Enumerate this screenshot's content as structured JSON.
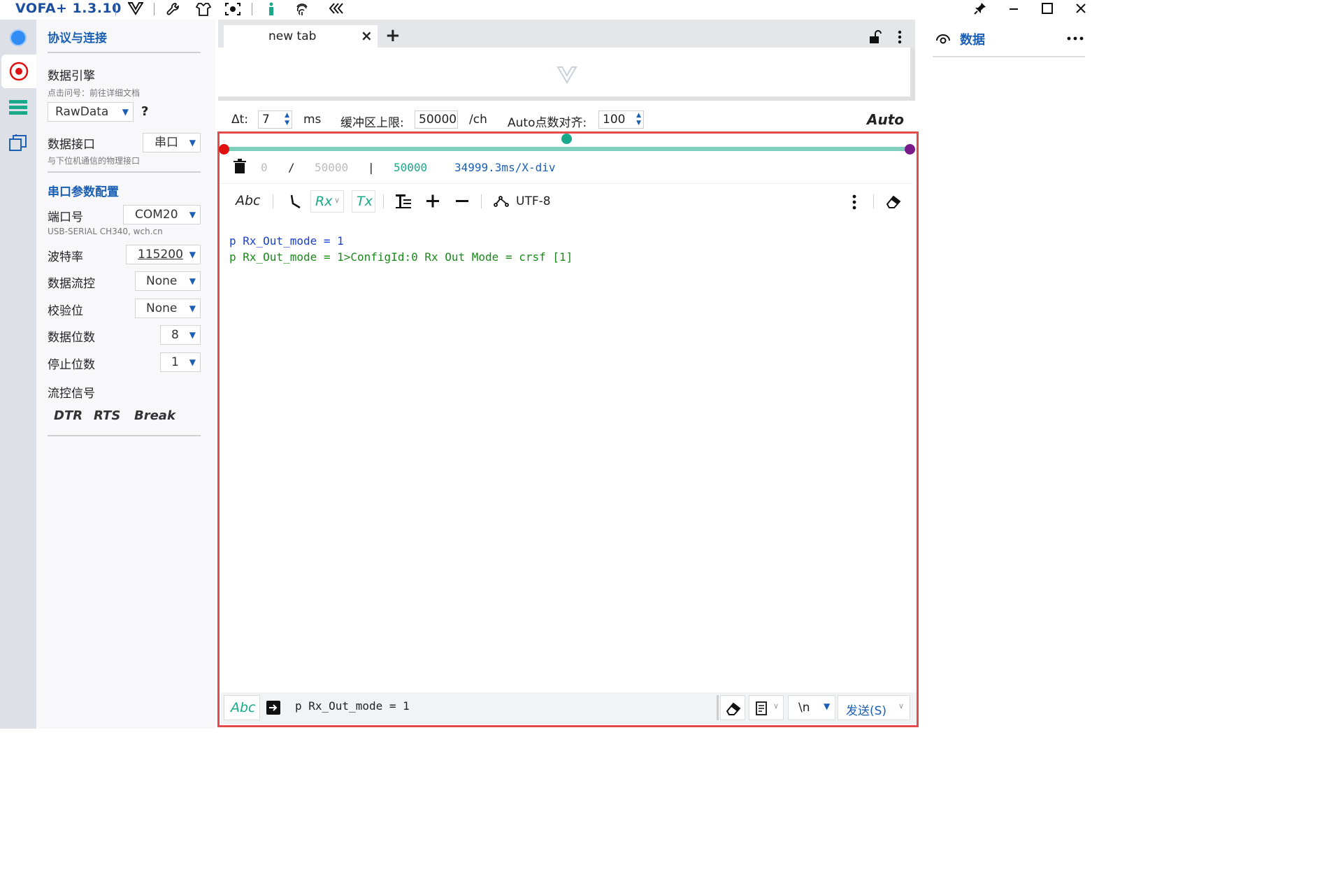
{
  "app": {
    "title": "VOFA+ 1.3.10"
  },
  "left_panel": {
    "section_title": "协议与连接",
    "engine_label": "数据引擎",
    "engine_hint": "点击问号：前往详细文档",
    "engine_value": "RawData",
    "help_label": "?",
    "interface_label": "数据接口",
    "interface_value": "串口",
    "interface_hint": "与下位机通信的物理接口",
    "serial_title": "串口参数配置",
    "port_label": "端口号",
    "port_value": "COM20",
    "port_hint": "USB-SERIAL CH340, wch.cn",
    "baud_label": "波特率",
    "baud_value": "115200",
    "flow_label": "数据流控",
    "flow_value": "None",
    "parity_label": "校验位",
    "parity_value": "None",
    "databits_label": "数据位数",
    "databits_value": "8",
    "stopbits_label": "停止位数",
    "stopbits_value": "1",
    "signals_label": "流控信号",
    "signals": {
      "dtr": "DTR",
      "rts": "RTS",
      "brk": "Break"
    }
  },
  "tabs": {
    "active_label": "new tab",
    "close_label": "×",
    "add_label": "+"
  },
  "stats": {
    "dt_label": "Δt:",
    "dt_value": "7",
    "dt_unit": "ms",
    "buffer_label": "缓冲区上限:",
    "buffer_value": "50000",
    "buffer_unit": "/ch",
    "align_label": "Auto点数对齐:",
    "align_value": "100",
    "mode_label": "Auto"
  },
  "counter": {
    "current": "0",
    "slash": "/",
    "total": "50000",
    "bar": "|",
    "buffer": "50000",
    "div": "34999.3ms/X-div"
  },
  "toolbar": {
    "abc": "Abc",
    "rx": "Rx",
    "tx": "Tx",
    "encoding": "UTF-8"
  },
  "terminal": {
    "lines": [
      "p Rx_Out_mode = 1",
      "p Rx_Out_mode = 1>ConfigId:0  Rx Out Mode = crsf [1]"
    ],
    "colors": {
      "tx": "#1a3fd0",
      "rx": "#1a8a1a"
    }
  },
  "send_bar": {
    "abc": "Abc",
    "input_value": "p Rx_Out_mode = 1",
    "line_ending": "\\n",
    "send_label": "发送(S)"
  },
  "right_panel": {
    "title": "数据"
  },
  "colors": {
    "accent": "#1a5fb4",
    "slider": "#7fcfbf",
    "frame": "#e64b4b",
    "dot_left": "#e01010",
    "dot_mid": "#1aa88a",
    "dot_right": "#7a1a8a"
  }
}
